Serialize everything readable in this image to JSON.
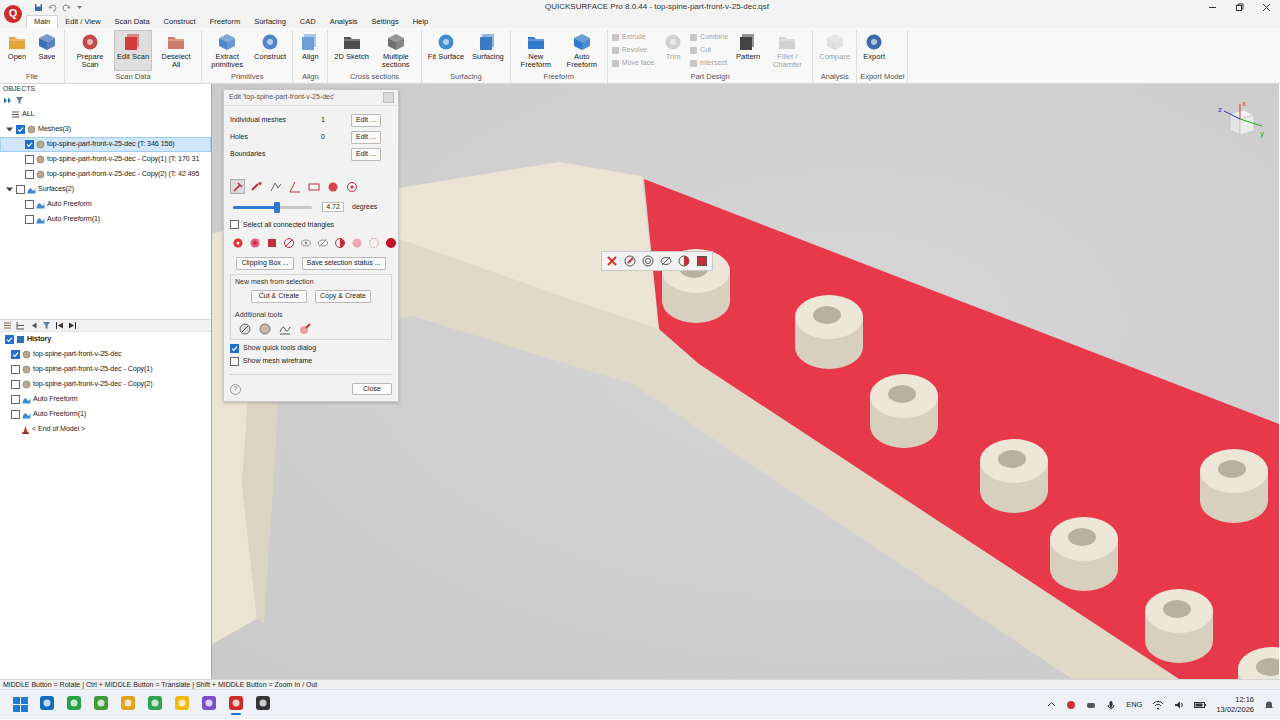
{
  "window": {
    "title": "QUICKSURFACE Pro 8.0.44 - top-spine-part-front-v-25-dec.qsf",
    "logo": "Q"
  },
  "menu_tabs": [
    {
      "label": "Main",
      "selected": true
    },
    {
      "label": "Edit / View",
      "selected": false
    },
    {
      "label": "Scan Data",
      "selected": false
    },
    {
      "label": "Construct",
      "selected": false
    },
    {
      "label": "Freeform",
      "selected": false
    },
    {
      "label": "Surfacing",
      "selected": false
    },
    {
      "label": "CAD",
      "selected": false
    },
    {
      "label": "Analysis",
      "selected": false
    },
    {
      "label": "Settings",
      "selected": false
    },
    {
      "label": "Help",
      "selected": false
    }
  ],
  "ribbon": [
    {
      "group": "File",
      "buttons": [
        {
          "label": "Open",
          "kind": "large",
          "disabled": false,
          "selected": false
        },
        {
          "label": "Save",
          "kind": "large",
          "disabled": false,
          "selected": false
        }
      ]
    },
    {
      "group": "Scan Data",
      "buttons": [
        {
          "label": "Prepare Scan",
          "kind": "large",
          "disabled": false,
          "selected": false
        },
        {
          "label": "Edit Scan",
          "kind": "large",
          "disabled": false,
          "selected": true
        },
        {
          "label": "Deselect All",
          "kind": "large",
          "disabled": false,
          "selected": false
        }
      ]
    },
    {
      "group": "Primitives",
      "buttons": [
        {
          "label": "Extract primitives",
          "kind": "large",
          "disabled": false,
          "selected": false
        },
        {
          "label": "Construct",
          "kind": "large",
          "disabled": false,
          "selected": false
        }
      ]
    },
    {
      "group": "Align",
      "buttons": [
        {
          "label": "Align",
          "kind": "large",
          "disabled": false,
          "selected": false
        }
      ]
    },
    {
      "group": "Cross sections",
      "buttons": [
        {
          "label": "2D Sketch",
          "kind": "large",
          "disabled": false,
          "selected": false
        },
        {
          "label": "Multiple sections",
          "kind": "large",
          "disabled": false,
          "selected": false
        }
      ]
    },
    {
      "group": "Surfacing",
      "buttons": [
        {
          "label": "Fit Surface",
          "kind": "large",
          "disabled": false,
          "selected": false
        },
        {
          "label": "Surfacing",
          "kind": "large",
          "disabled": false,
          "selected": false
        }
      ]
    },
    {
      "group": "Freeform",
      "buttons": [
        {
          "label": "New Freeform",
          "kind": "large",
          "disabled": false,
          "selected": false
        },
        {
          "label": "Auto Freeform",
          "kind": "large",
          "disabled": false,
          "selected": false
        }
      ]
    },
    {
      "group": "Part Design",
      "buttons": [
        {
          "label": "Extrude",
          "kind": "small",
          "disabled": true,
          "selected": false
        },
        {
          "label": "Revolve",
          "kind": "small",
          "disabled": true,
          "selected": false
        },
        {
          "label": "Move face",
          "kind": "small",
          "disabled": true,
          "selected": false
        },
        {
          "label": "Trim",
          "kind": "large",
          "disabled": true,
          "selected": false
        },
        {
          "label": "Combine",
          "kind": "small",
          "disabled": true,
          "selected": false
        },
        {
          "label": "Cut",
          "kind": "small",
          "disabled": true,
          "selected": false
        },
        {
          "label": "Intersect",
          "kind": "small",
          "disabled": true,
          "selected": false
        },
        {
          "label": "Pattern",
          "kind": "large",
          "disabled": false,
          "selected": false
        },
        {
          "label": "Fillet / Chamfer",
          "kind": "large",
          "disabled": true,
          "selected": false
        }
      ]
    },
    {
      "group": "Analysis",
      "buttons": [
        {
          "label": "Compare",
          "kind": "large",
          "disabled": true,
          "selected": false
        }
      ]
    },
    {
      "group": "Export Model",
      "buttons": [
        {
          "label": "Export",
          "kind": "large",
          "disabled": false,
          "selected": false
        }
      ]
    }
  ],
  "objects": {
    "header": "OBJECTS",
    "tree": [
      {
        "kind": "all",
        "label": "ALL",
        "selected": false
      },
      {
        "kind": "mesh-group",
        "label": "Meshes(3)",
        "expanded": true,
        "checked": true,
        "selected": false
      },
      {
        "kind": "mesh",
        "label": "top-spine-part-front-v-25-dec (T: 346 156)",
        "checked": true,
        "selected": true
      },
      {
        "kind": "mesh",
        "label": "top-spine-part-front-v-25-dec - Copy(1) (T: 170 31",
        "checked": false,
        "selected": false
      },
      {
        "kind": "mesh",
        "label": "top-spine-part-front-v-25-dec - Copy(2) (T: 42 495",
        "checked": false,
        "selected": false
      },
      {
        "kind": "surface-group",
        "label": "Surfaces(2)",
        "expanded": true,
        "checked": false,
        "selected": false
      },
      {
        "kind": "surface",
        "label": "Auto Freeform",
        "checked": false,
        "selected": false
      },
      {
        "kind": "surface",
        "label": "Auto Freeform(1)",
        "checked": false,
        "selected": false
      }
    ]
  },
  "history": {
    "title": "History",
    "checked": true,
    "items": [
      {
        "kind": "mesh",
        "label": "top-spine-part-front-v-25-dec",
        "checked": true
      },
      {
        "kind": "mesh",
        "label": "top-spine-part-front-v-25-dec - Copy(1)",
        "checked": false
      },
      {
        "kind": "mesh",
        "label": "top-spine-part-front-v-25-dec - Copy(2)",
        "checked": false
      },
      {
        "kind": "surface",
        "label": "Auto Freeform",
        "checked": false
      },
      {
        "kind": "surface",
        "label": "Auto Freeform(1)",
        "checked": false
      },
      {
        "kind": "end",
        "label": "< End of Model >"
      }
    ]
  },
  "edit_dialog": {
    "title": "Edit 'top-spine-part-front-v-25-dec'",
    "rows": [
      {
        "label": "Individual meshes",
        "value": "1",
        "button": "Edit ..."
      },
      {
        "label": "Holes",
        "value": "0",
        "button": "Edit ..."
      },
      {
        "label": "Boundaries",
        "button": "Edit ..."
      }
    ],
    "tools": [
      {
        "selected": true
      },
      {
        "selected": false
      },
      {
        "selected": false
      },
      {
        "selected": false
      },
      {
        "selected": false
      },
      {
        "selected": false
      },
      {
        "selected": false
      }
    ],
    "angle": {
      "level": 0.56,
      "value": "4.72",
      "unit": "degrees"
    },
    "connected": {
      "label": "Select all connected triangles",
      "checked": false
    },
    "selection_buttons": [
      "Clipping Box ...",
      "Save selection status ..."
    ],
    "new_mesh": {
      "label": "New mesh from selection",
      "buttons": [
        "Cut & Create",
        "Copy & Create"
      ]
    },
    "additional": {
      "label": "Additional tools"
    },
    "options": [
      {
        "label": "Show quick tools dialog",
        "checked": true
      },
      {
        "label": "Show mesh wireframe",
        "checked": false
      }
    ],
    "help": "?",
    "close": "Close"
  },
  "view": {
    "axes": [
      "x",
      "z",
      "y"
    ]
  },
  "status_bar": "MIDDLE Button = Rotate | Ctrl + MIDDLE Button = Translate | Shift + MIDDLE Button = Zoom In / Out",
  "taskbar": {
    "apps": [
      {
        "selected": false
      },
      {
        "selected": false
      },
      {
        "selected": false
      },
      {
        "selected": false
      },
      {
        "selected": false
      },
      {
        "selected": false
      },
      {
        "selected": false
      },
      {
        "selected": true
      },
      {
        "selected": false
      }
    ],
    "language": "ENG",
    "time": "12:16",
    "date": "13/02/2026"
  }
}
